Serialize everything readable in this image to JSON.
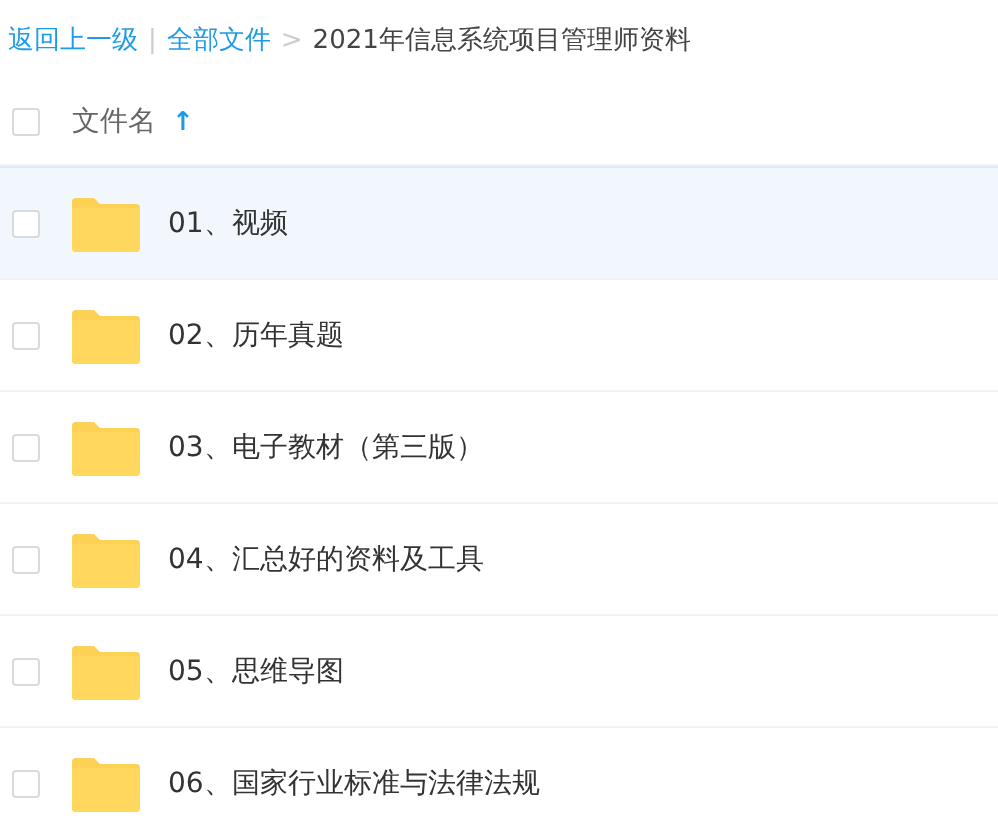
{
  "breadcrumb": {
    "back": "返回上一级",
    "separator": "|",
    "root": "全部文件",
    "arrow": ">",
    "current": "2021年信息系统项目管理师资料"
  },
  "header": {
    "checked": false,
    "label": "文件名",
    "sort": "↑"
  },
  "files": [
    {
      "name": "01、视频",
      "checked": false,
      "hovered": true
    },
    {
      "name": "02、历年真题",
      "checked": false,
      "hovered": false
    },
    {
      "name": "03、电子教材（第三版）",
      "checked": false,
      "hovered": false
    },
    {
      "name": "04、汇总好的资料及工具",
      "checked": false,
      "hovered": false
    },
    {
      "name": "05、思维导图",
      "checked": false,
      "hovered": false
    },
    {
      "name": "06、国家行业标准与法律法规",
      "checked": false,
      "hovered": false
    }
  ]
}
